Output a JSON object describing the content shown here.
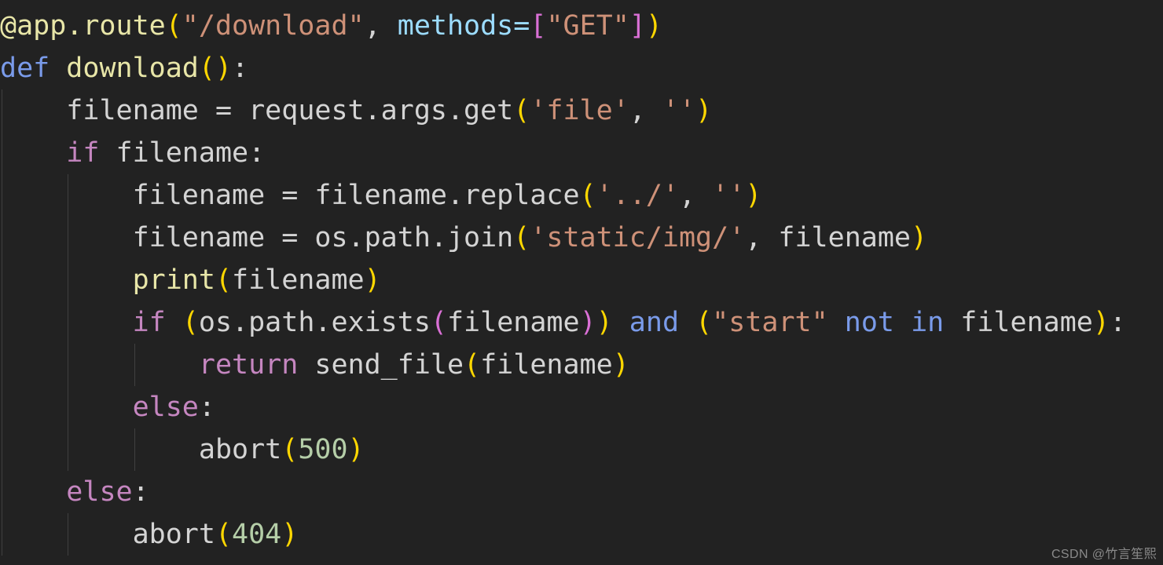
{
  "editor": {
    "language": "python",
    "background_color": "#222222",
    "default_text_color": "#d4d4d4",
    "indent_guide_color": "#404040",
    "font_size_px": 35,
    "line_height_px": 54,
    "theme_colors": {
      "keyword_control": "#c586c0",
      "keyword_operator": "#7a9bea",
      "function": "#e8e6a8",
      "string": "#ce9178",
      "number": "#b5cea8",
      "parameter": "#9cdcfe",
      "bracket_level_1": "#ffd700",
      "bracket_level_2": "#da70d6",
      "bracket_level_3": "#179fff"
    }
  },
  "code": {
    "plain_text": "@app.route(\"/download\", methods=[\"GET\"])\ndef download():\n    filename = request.args.get('file', '')\n    if filename:\n        filename = filename.replace('../', '')\n        filename = os.path.join('static/img/', filename)\n        print(filename)\n        if (os.path.exists(filename)) and (\"start\" not in filename):\n            return send_file(filename)\n        else:\n            abort(500)\n    else:\n        abort(404)",
    "lines": [
      {
        "indent": 0,
        "guides": [],
        "tokens": [
          {
            "text": "@app.route",
            "cls": "t-func"
          },
          {
            "text": "(",
            "cls": "t-br1"
          },
          {
            "text": "\"/download\"",
            "cls": "t-str"
          },
          {
            "text": ", ",
            "cls": "t-plain"
          },
          {
            "text": "methods",
            "cls": "t-prop"
          },
          {
            "text": "=",
            "cls": "t-prop"
          },
          {
            "text": "[",
            "cls": "t-br2"
          },
          {
            "text": "\"GET\"",
            "cls": "t-str"
          },
          {
            "text": "]",
            "cls": "t-br2"
          },
          {
            "text": ")",
            "cls": "t-br1"
          }
        ]
      },
      {
        "indent": 0,
        "guides": [],
        "tokens": [
          {
            "text": "def",
            "cls": "t-kw2"
          },
          {
            "text": " ",
            "cls": "t-plain"
          },
          {
            "text": "download",
            "cls": "t-func"
          },
          {
            "text": "(",
            "cls": "t-br1"
          },
          {
            "text": ")",
            "cls": "t-br1"
          },
          {
            "text": ":",
            "cls": "t-plain"
          }
        ]
      },
      {
        "indent": 1,
        "guides": [
          0
        ],
        "tokens": [
          {
            "text": "    ",
            "cls": "t-plain"
          },
          {
            "text": "filename ",
            "cls": "t-plain"
          },
          {
            "text": "=",
            "cls": "t-op"
          },
          {
            "text": " request.args.get",
            "cls": "t-plain"
          },
          {
            "text": "(",
            "cls": "t-br1"
          },
          {
            "text": "'file'",
            "cls": "t-str"
          },
          {
            "text": ", ",
            "cls": "t-plain"
          },
          {
            "text": "''",
            "cls": "t-str"
          },
          {
            "text": ")",
            "cls": "t-br1"
          }
        ]
      },
      {
        "indent": 1,
        "guides": [
          0
        ],
        "tokens": [
          {
            "text": "    ",
            "cls": "t-plain"
          },
          {
            "text": "if",
            "cls": "t-kw"
          },
          {
            "text": " filename:",
            "cls": "t-plain"
          }
        ]
      },
      {
        "indent": 2,
        "guides": [
          0,
          1
        ],
        "tokens": [
          {
            "text": "        ",
            "cls": "t-plain"
          },
          {
            "text": "filename ",
            "cls": "t-plain"
          },
          {
            "text": "=",
            "cls": "t-op"
          },
          {
            "text": " filename.replace",
            "cls": "t-plain"
          },
          {
            "text": "(",
            "cls": "t-br1"
          },
          {
            "text": "'../'",
            "cls": "t-str"
          },
          {
            "text": ", ",
            "cls": "t-plain"
          },
          {
            "text": "''",
            "cls": "t-str"
          },
          {
            "text": ")",
            "cls": "t-br1"
          }
        ]
      },
      {
        "indent": 2,
        "guides": [
          0,
          1
        ],
        "tokens": [
          {
            "text": "        ",
            "cls": "t-plain"
          },
          {
            "text": "filename ",
            "cls": "t-plain"
          },
          {
            "text": "=",
            "cls": "t-op"
          },
          {
            "text": " os.path.join",
            "cls": "t-plain"
          },
          {
            "text": "(",
            "cls": "t-br1"
          },
          {
            "text": "'static/img/'",
            "cls": "t-str"
          },
          {
            "text": ", filename",
            "cls": "t-plain"
          },
          {
            "text": ")",
            "cls": "t-br1"
          }
        ]
      },
      {
        "indent": 2,
        "guides": [
          0,
          1
        ],
        "tokens": [
          {
            "text": "        ",
            "cls": "t-plain"
          },
          {
            "text": "print",
            "cls": "t-func"
          },
          {
            "text": "(",
            "cls": "t-br1"
          },
          {
            "text": "filename",
            "cls": "t-plain"
          },
          {
            "text": ")",
            "cls": "t-br1"
          }
        ]
      },
      {
        "indent": 2,
        "guides": [
          0,
          1
        ],
        "tokens": [
          {
            "text": "        ",
            "cls": "t-plain"
          },
          {
            "text": "if",
            "cls": "t-kw"
          },
          {
            "text": " ",
            "cls": "t-plain"
          },
          {
            "text": "(",
            "cls": "t-br1"
          },
          {
            "text": "os.path.exists",
            "cls": "t-plain"
          },
          {
            "text": "(",
            "cls": "t-br2"
          },
          {
            "text": "filename",
            "cls": "t-plain"
          },
          {
            "text": ")",
            "cls": "t-br2"
          },
          {
            "text": ")",
            "cls": "t-br1"
          },
          {
            "text": " ",
            "cls": "t-plain"
          },
          {
            "text": "and",
            "cls": "t-kw2"
          },
          {
            "text": " ",
            "cls": "t-plain"
          },
          {
            "text": "(",
            "cls": "t-br1"
          },
          {
            "text": "\"start\"",
            "cls": "t-str"
          },
          {
            "text": " ",
            "cls": "t-plain"
          },
          {
            "text": "not",
            "cls": "t-kw2"
          },
          {
            "text": " ",
            "cls": "t-plain"
          },
          {
            "text": "in",
            "cls": "t-kw2"
          },
          {
            "text": " filename",
            "cls": "t-plain"
          },
          {
            "text": ")",
            "cls": "t-br1"
          },
          {
            "text": ":",
            "cls": "t-plain"
          }
        ]
      },
      {
        "indent": 3,
        "guides": [
          0,
          1,
          2
        ],
        "tokens": [
          {
            "text": "            ",
            "cls": "t-plain"
          },
          {
            "text": "return",
            "cls": "t-kw"
          },
          {
            "text": " send_file",
            "cls": "t-plain"
          },
          {
            "text": "(",
            "cls": "t-br1"
          },
          {
            "text": "filename",
            "cls": "t-plain"
          },
          {
            "text": ")",
            "cls": "t-br1"
          }
        ]
      },
      {
        "indent": 2,
        "guides": [
          0,
          1
        ],
        "tokens": [
          {
            "text": "        ",
            "cls": "t-plain"
          },
          {
            "text": "else",
            "cls": "t-kw"
          },
          {
            "text": ":",
            "cls": "t-plain"
          }
        ]
      },
      {
        "indent": 3,
        "guides": [
          0,
          1,
          2
        ],
        "tokens": [
          {
            "text": "            ",
            "cls": "t-plain"
          },
          {
            "text": "abort",
            "cls": "t-plain"
          },
          {
            "text": "(",
            "cls": "t-br1"
          },
          {
            "text": "500",
            "cls": "t-num"
          },
          {
            "text": ")",
            "cls": "t-br1"
          }
        ]
      },
      {
        "indent": 1,
        "guides": [
          0
        ],
        "tokens": [
          {
            "text": "    ",
            "cls": "t-plain"
          },
          {
            "text": "else",
            "cls": "t-kw"
          },
          {
            "text": ":",
            "cls": "t-plain"
          }
        ]
      },
      {
        "indent": 2,
        "guides": [
          0,
          1
        ],
        "tokens": [
          {
            "text": "        ",
            "cls": "t-plain"
          },
          {
            "text": "abort",
            "cls": "t-plain"
          },
          {
            "text": "(",
            "cls": "t-br1"
          },
          {
            "text": "404",
            "cls": "t-num"
          },
          {
            "text": ")",
            "cls": "t-br1"
          }
        ]
      }
    ]
  },
  "watermark": {
    "text": "CSDN @竹言笙熙"
  }
}
